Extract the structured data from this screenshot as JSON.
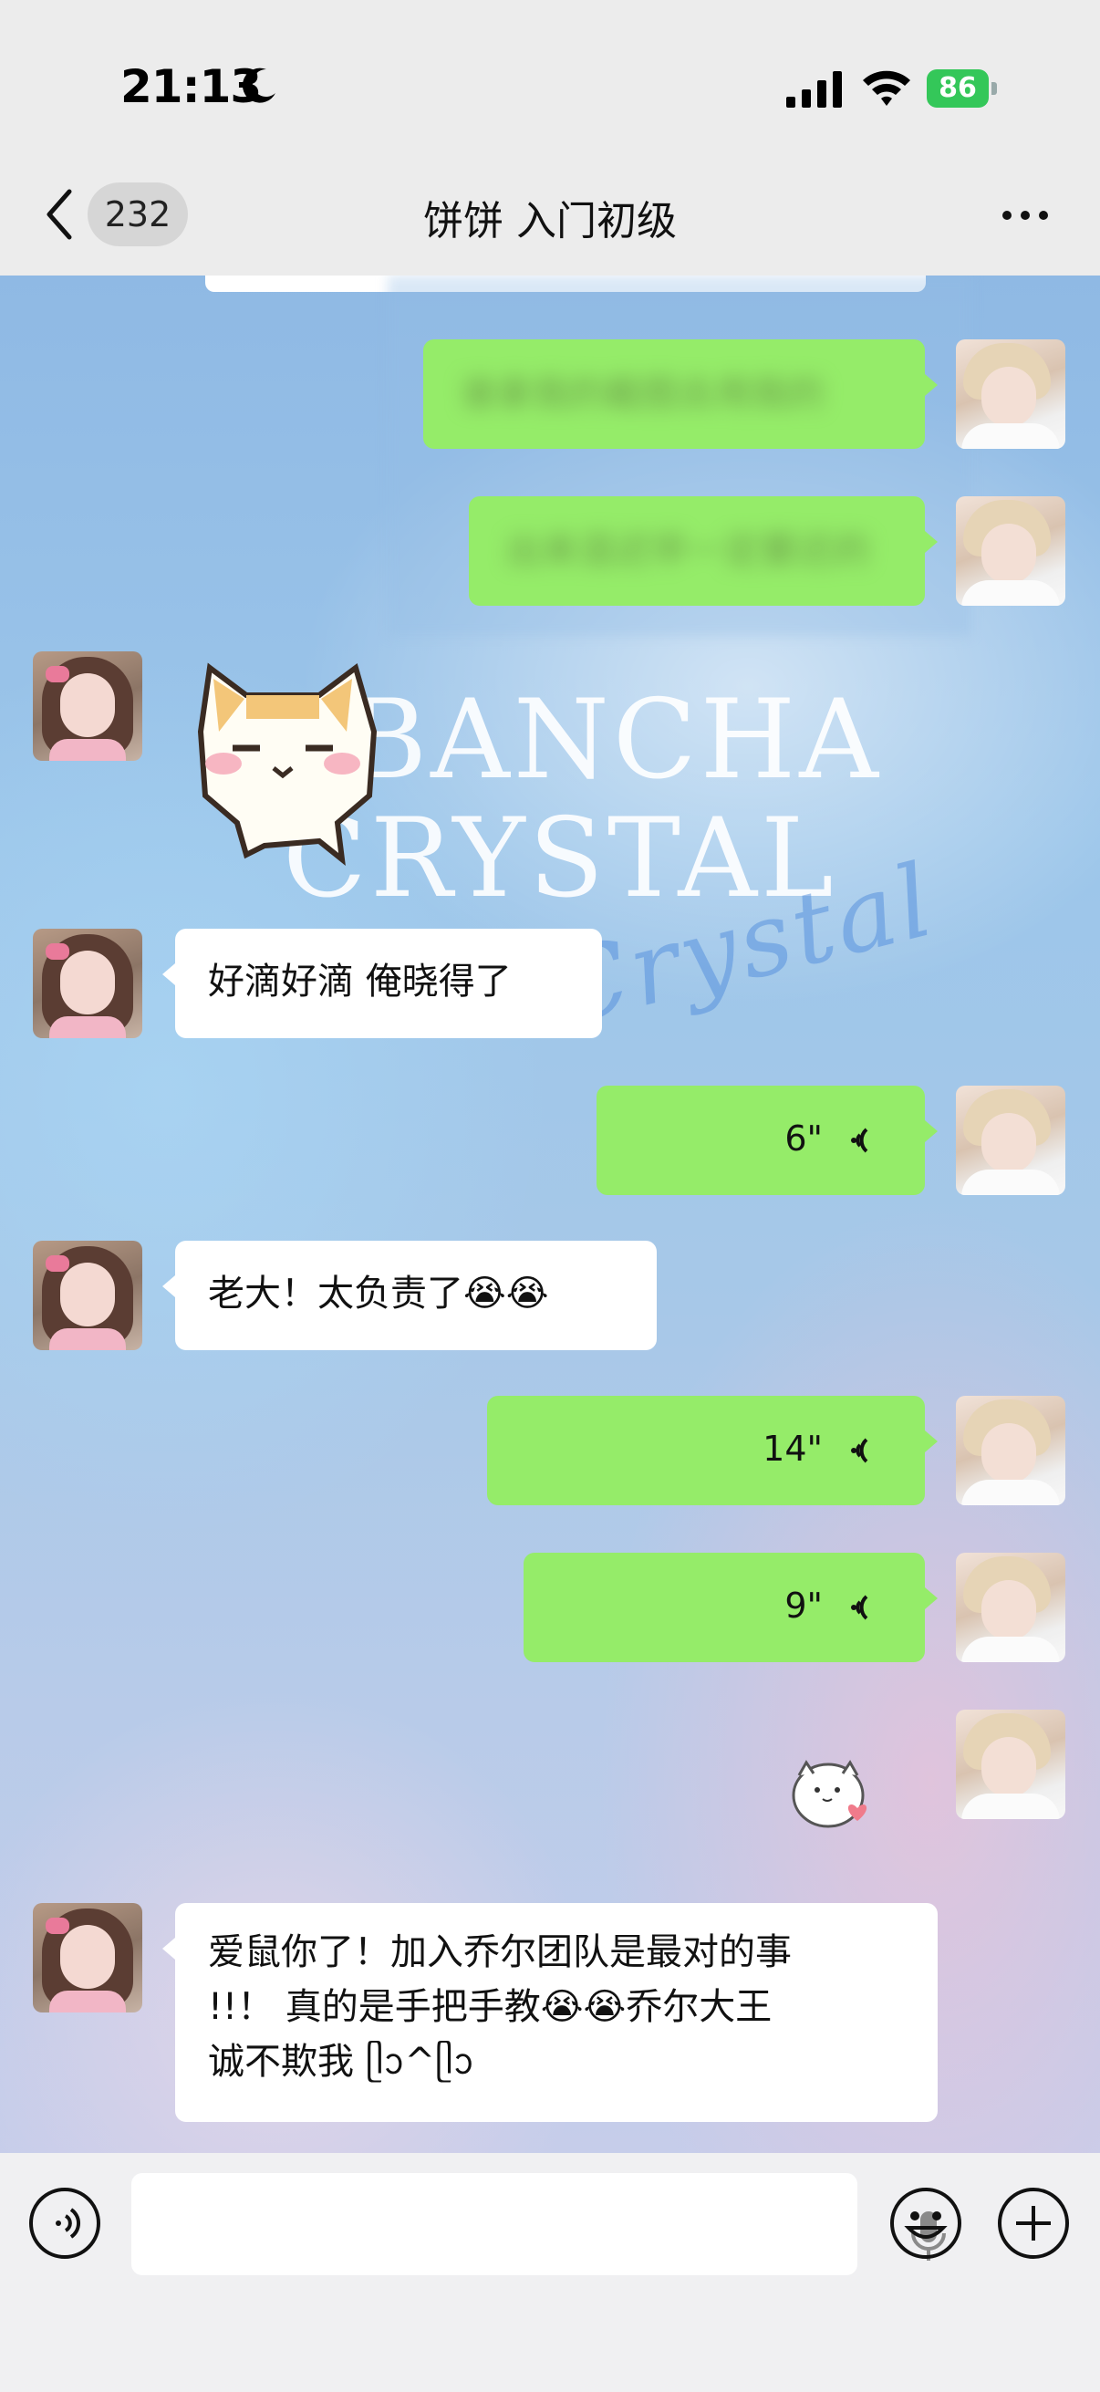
{
  "status_bar": {
    "time": "21:13",
    "battery": "86"
  },
  "nav": {
    "unread_count": "232",
    "title": "饼饼 入门初级"
  },
  "wallpaper": {
    "line1": "BANCHA",
    "line2": "CRYSTAL",
    "script": "Crystal"
  },
  "messages": [
    {
      "side": "right",
      "kind": "text",
      "blurred": true,
      "text": "谁拿我的截图去用我的"
    },
    {
      "side": "right",
      "kind": "text",
      "blurred": true,
      "text": "出来混迟早一定要还的"
    },
    {
      "side": "left",
      "kind": "sticker",
      "sticker": "pixel-cat-sticker"
    },
    {
      "side": "left",
      "kind": "text",
      "text": "好滴好滴 俺晓得了"
    },
    {
      "side": "right",
      "kind": "voice",
      "duration": "6\""
    },
    {
      "side": "left",
      "kind": "text",
      "text_parts": [
        "老大！太负责了",
        "😭😭"
      ]
    },
    {
      "side": "right",
      "kind": "voice",
      "duration": "14\""
    },
    {
      "side": "right",
      "kind": "voice",
      "duration": "9\""
    },
    {
      "side": "right",
      "kind": "sticker",
      "sticker": "white-cat-heart-sticker"
    },
    {
      "side": "left",
      "kind": "text",
      "lines": [
        "爱鼠你了！加入乔尔团队是最对的事",
        "!!！ 真的是手把手教",
        "乔尔大王",
        "诚不欺我 ᥫᩣ^ᥫᩣ"
      ]
    }
  ],
  "colors": {
    "bubble_right": "#95ec69",
    "bubble_left": "#ffffff",
    "battery": "#34c759"
  }
}
